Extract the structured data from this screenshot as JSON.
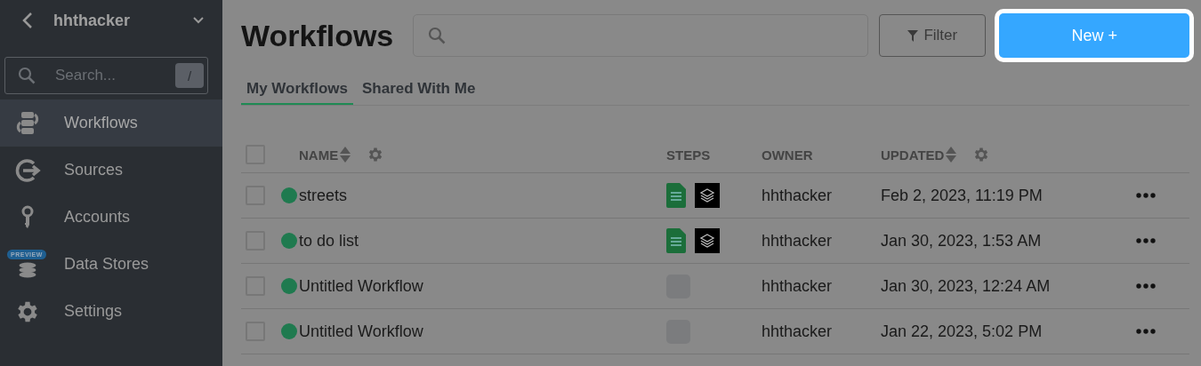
{
  "sidebar": {
    "account": "hhthacker",
    "search": {
      "placeholder": "Search...",
      "shortcut": "/"
    },
    "items": [
      {
        "kind": "workflows",
        "label": "Workflows",
        "selected": true
      },
      {
        "kind": "sources",
        "label": "Sources",
        "selected": false
      },
      {
        "kind": "accounts",
        "label": "Accounts",
        "selected": false
      },
      {
        "kind": "datastores",
        "label": "Data Stores",
        "selected": false,
        "badge": "PREVIEW"
      },
      {
        "kind": "settings",
        "label": "Settings",
        "selected": false
      }
    ]
  },
  "header": {
    "title": "Workflows",
    "filter": "Filter",
    "new": "New +"
  },
  "tabs": [
    {
      "label": "My Workflows",
      "selected": true
    },
    {
      "label": "Shared With Me",
      "selected": false
    }
  ],
  "table": {
    "columns": {
      "name": "NAME",
      "steps": "STEPS",
      "owner": "OWNER",
      "updated": "UPDATED"
    },
    "all_checked": false,
    "rows": [
      {
        "checked": false,
        "name": "streets",
        "steps": [
          {
            "kind": "sheets"
          },
          {
            "kind": "layers"
          }
        ],
        "owner": "hhthacker",
        "updated": "Feb 2, 2023, 11:19 PM"
      },
      {
        "checked": false,
        "name": "to do list",
        "steps": [
          {
            "kind": "sheets"
          },
          {
            "kind": "layers"
          }
        ],
        "owner": "hhthacker",
        "updated": "Jan 30, 2023, 1:53 AM"
      },
      {
        "checked": false,
        "name": "Untitled Workflow",
        "steps": [
          {
            "kind": "empty"
          }
        ],
        "owner": "hhthacker",
        "updated": "Jan 30, 2023, 12:24 AM"
      },
      {
        "checked": false,
        "name": "Untitled Workflow",
        "steps": [
          {
            "kind": "empty"
          }
        ],
        "owner": "hhthacker",
        "updated": "Jan 22, 2023, 5:02 PM"
      }
    ]
  }
}
